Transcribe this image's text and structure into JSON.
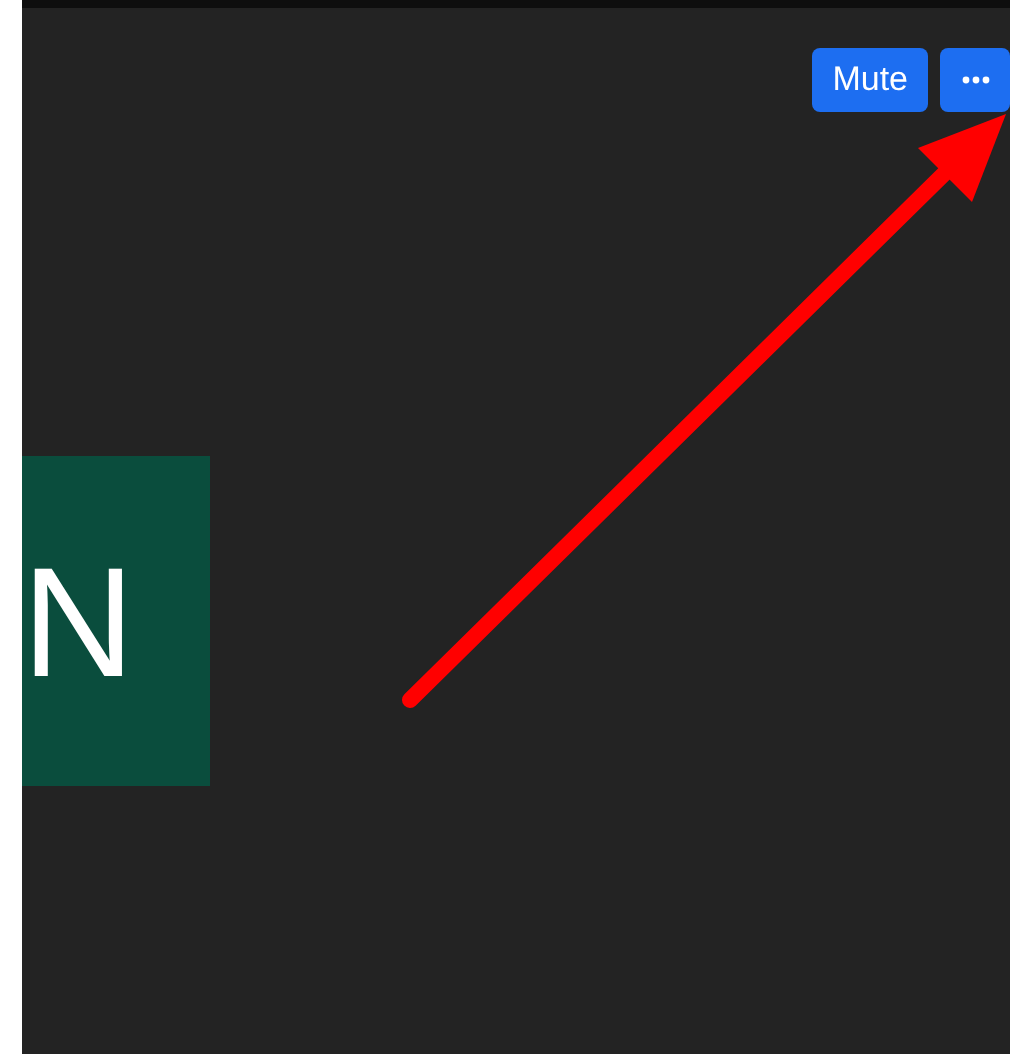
{
  "participant": {
    "initial": "N"
  },
  "controls": {
    "mute_label": "Mute"
  }
}
